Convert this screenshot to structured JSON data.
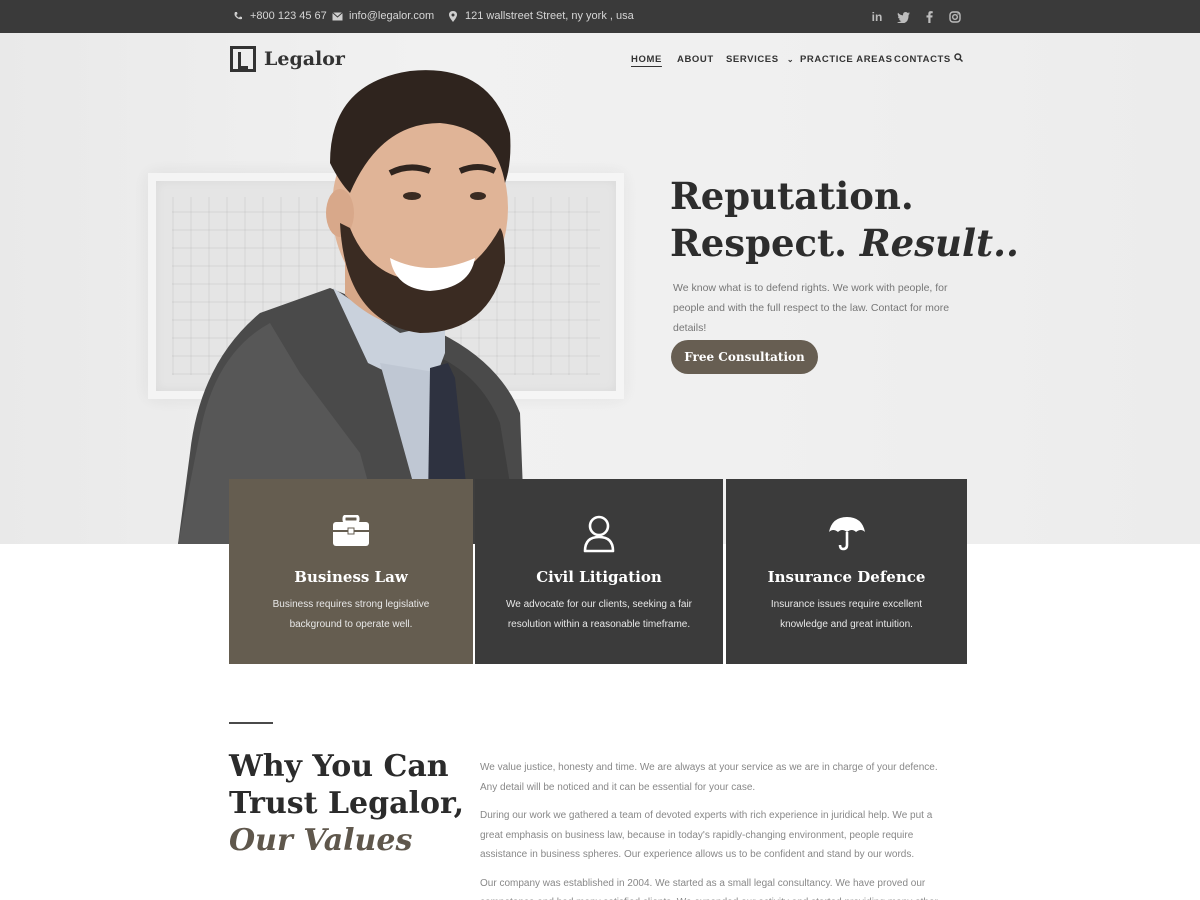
{
  "topbar": {
    "phone": "+800 123 45 67",
    "email": "info@legalor.com",
    "address": "121 wallstreet Street, ny york , usa",
    "social": [
      "in",
      "t",
      "f",
      "ig"
    ]
  },
  "brand": {
    "name": "Legalor"
  },
  "nav": {
    "items": [
      "HOME",
      "ABOUT",
      "SERVICES",
      "PRACTICE AREAS",
      "CONTACTS"
    ],
    "active": "HOME"
  },
  "hero": {
    "line1": "Reputation.",
    "line2a": "Respect. ",
    "line2b": "Result..",
    "lead": "We know what is to defend rights. We work with people, for people and with the full respect to the law. Contact for more details!",
    "cta": "Free Consultation"
  },
  "cards": [
    {
      "title": "Business Law",
      "text": "Business requires strong legislative background to operate well.",
      "icon": "briefcase-icon",
      "color": "#655d50"
    },
    {
      "title": "Civil Litigation",
      "text": "We advocate for our clients, seeking a fair resolution within a reasonable timeframe.",
      "icon": "person-icon",
      "color": "#3b3b3b"
    },
    {
      "title": "Insurance Defence",
      "text": "Insurance issues require excellent knowledge and great intuition.",
      "icon": "umbrella-icon",
      "color": "#3b3b3b"
    }
  ],
  "about": {
    "heading1": "Why You Can",
    "heading2": "Trust Legalor,",
    "heading3": "Our Values",
    "p1": "We value justice, honesty and time. We are always at your service as we are in charge of your defence. Any detail will be noticed and it can be essential for your case.",
    "p2": "During our work we gathered a team of devoted experts with rich experience in juridical help. We put a great emphasis on business law, because in today's rapidly-changing environment, people require assistance in business spheres. Our experience allows us to be confident and stand by our words.",
    "p3": "Our company was established in 2004. We started as a small legal consultancy. We have proved our competence and had many satisfied clients. We expanded our activity and started providing many other"
  },
  "colors": {
    "accent": "#675e52",
    "dark": "#3b3b3b",
    "topbar": "#3a3a3a"
  }
}
